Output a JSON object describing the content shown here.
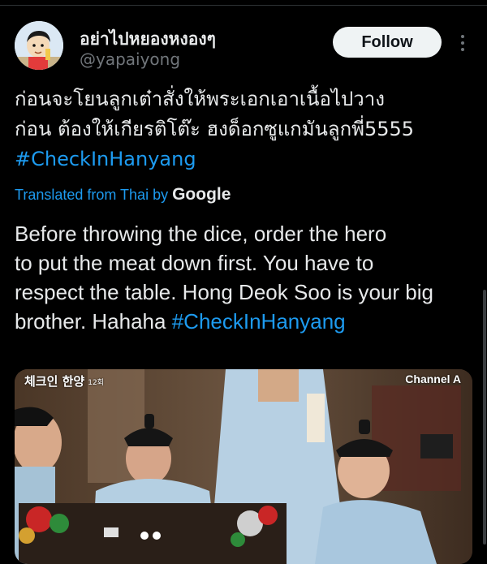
{
  "tweet": {
    "author": {
      "display_name": "อย่าไปหยองหงองๆ",
      "handle": "@yapaiyong"
    },
    "follow_label": "Follow",
    "more_icon": "more-vertical-icon",
    "text_lines": [
      "ก่อนจะโยนลูกเต๋าสั่งให้พระเอกเอาเนื้อไปวาง",
      "ก่อน ต้องให้เกียรติโต๊ะ ฮงด็อกซูแกมันลูกพี่5555"
    ],
    "hashtag": "#CheckInHanyang",
    "translation": {
      "label": "Translated from Thai by",
      "provider": "Google",
      "lines": [
        "Before throwing the dice, order the hero",
        "to put the meat down first. You have to",
        "respect the table. Hong Deok Soo is your big",
        "brother. Hahaha "
      ],
      "hashtag": "#CheckInHanyang"
    },
    "media": {
      "show_title": "체크인 한양",
      "episode": "12회",
      "channel": "Channel A"
    }
  },
  "colors": {
    "background": "#000000",
    "text": "#e7e9ea",
    "secondary": "#71767b",
    "link": "#1d9bf0",
    "follow_bg": "#eff3f4"
  }
}
